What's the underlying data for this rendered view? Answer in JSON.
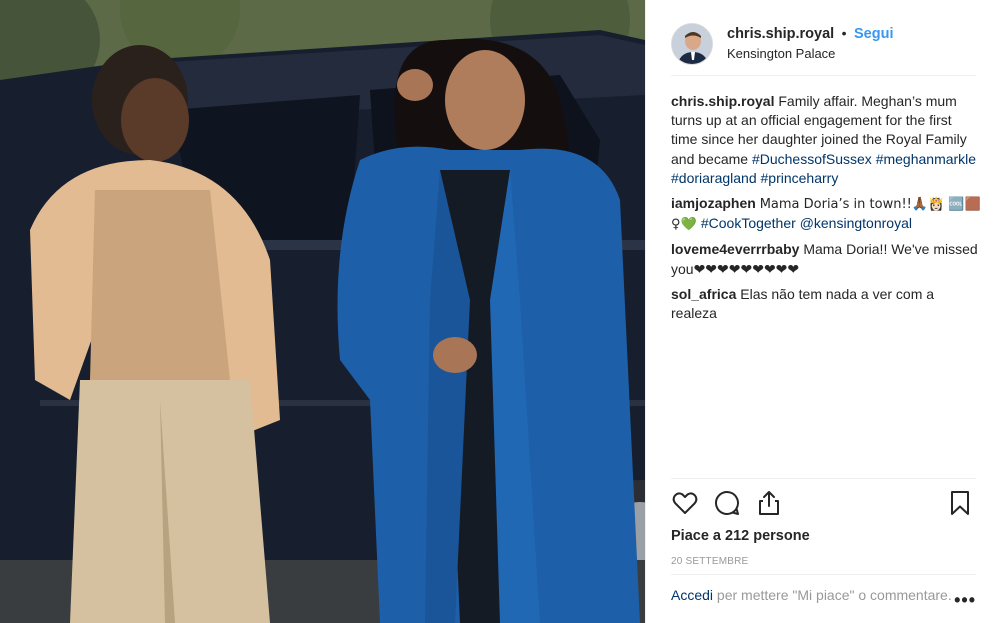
{
  "post": {
    "username": "chris.ship.royal",
    "follow_label": "Segui",
    "location": "Kensington Palace",
    "separator": "•"
  },
  "comments": [
    {
      "user": "chris.ship.royal",
      "text": "Family affair. Meghan’s mum turns up at an official engagement for the first time since her daughter joined the Royal Family and became ",
      "tags": [
        "#DuchessofSussex",
        "#meghanmarkle",
        "#doriaragland",
        "#princeharry"
      ]
    },
    {
      "user": "iamjozaphen",
      "text": "Mama Doria’s in town!!🙏🏾👸🏻 🆒🟫♀💚 ",
      "tags": [
        "#CookTogether",
        "@kensingtonroyal"
      ]
    },
    {
      "user": "loveme4everrrbaby",
      "text": "Mama Doria!! We've missed you❤❤❤❤❤❤❤❤❤",
      "tags": []
    },
    {
      "user": "sol_africa",
      "text": "Elas não tem nada a ver com a realeza",
      "tags": []
    }
  ],
  "actions": {
    "icons": [
      "heart-icon",
      "comment-icon",
      "share-icon",
      "bookmark-icon"
    ],
    "likes_label": "Piace a 212 persone",
    "date": "20 SETTEMBRE"
  },
  "login": {
    "link": "Accedi",
    "text": " per mettere \"Mi piace\" o commentare.",
    "more": "•••"
  },
  "colors": {
    "accent": "#3897f0",
    "link": "#003569",
    "coat": "#1d5fa8"
  }
}
